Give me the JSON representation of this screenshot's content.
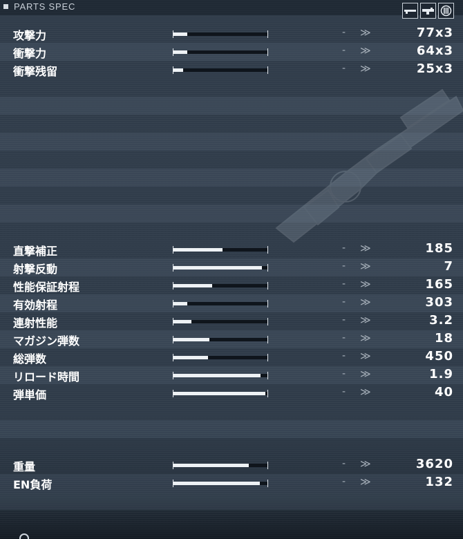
{
  "header": {
    "title": "PARTS SPEC",
    "icons": [
      "rifle-icon",
      "launcher-icon",
      "magazine-icon"
    ]
  },
  "stats_top": [
    {
      "label": "攻撃力",
      "fill": 0.15,
      "change": "-",
      "value": "77x3"
    },
    {
      "label": "衝撃力",
      "fill": 0.15,
      "change": "-",
      "value": "64x3"
    },
    {
      "label": "衝撃残留",
      "fill": 0.1,
      "change": "-",
      "value": "25x3"
    }
  ],
  "stats_mid": [
    {
      "label": "直撃補正",
      "fill": 0.52,
      "change": "-",
      "value": "185"
    },
    {
      "label": "射撃反動",
      "fill": 0.94,
      "change": "-",
      "value": "7"
    },
    {
      "label": "性能保証射程",
      "fill": 0.41,
      "change": "-",
      "value": "165"
    },
    {
      "label": "有効射程",
      "fill": 0.15,
      "change": "-",
      "value": "303"
    },
    {
      "label": "連射性能",
      "fill": 0.19,
      "change": "-",
      "value": "3.2"
    },
    {
      "label": "マガジン弾数",
      "fill": 0.38,
      "change": "-",
      "value": "18"
    },
    {
      "label": "総弾数",
      "fill": 0.37,
      "change": "-",
      "value": "450"
    },
    {
      "label": "リロード時間",
      "fill": 0.93,
      "change": "-",
      "value": "1.9"
    },
    {
      "label": "弾単価",
      "fill": 0.98,
      "change": "-",
      "value": "40"
    }
  ],
  "stats_bottom": [
    {
      "label": "重量",
      "fill": 0.8,
      "change": "-",
      "value": "3620"
    },
    {
      "label": "EN負荷",
      "fill": 0.92,
      "change": "-",
      "value": "132"
    }
  ],
  "colors": {
    "background": "#2f3b49",
    "bar_fill": "#eef2f5",
    "bar_track": "#0f151c",
    "text": "#ffffff",
    "muted": "#a7b0ba"
  },
  "arrow_glyph": "≫"
}
